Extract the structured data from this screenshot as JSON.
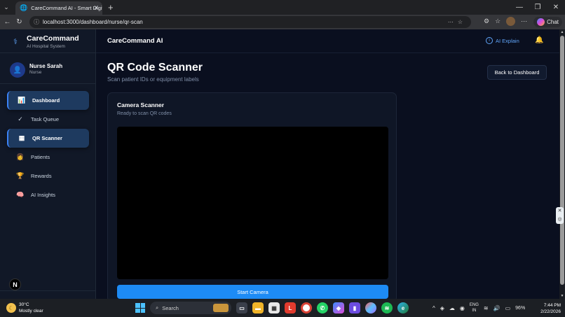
{
  "browser": {
    "tab_title": "CareCommand AI - Smart Digital H",
    "url": "localhost:3000/dashboard/nurse/qr-scan",
    "chat_label": "Chat"
  },
  "sidebar": {
    "brand_name": "CareCommand",
    "brand_sub": "AI Hospital System",
    "user_name": "Nurse Sarah",
    "user_role": "Nurse",
    "items": [
      {
        "label": "Dashboard",
        "icon": "📊"
      },
      {
        "label": "Task Queue",
        "icon": "✓"
      },
      {
        "label": "QR Scanner",
        "icon": "▦"
      },
      {
        "label": "Patients",
        "icon": "👩"
      },
      {
        "label": "Rewards",
        "icon": "🏆"
      },
      {
        "label": "AI Insights",
        "icon": "🧠"
      }
    ],
    "badge": "N"
  },
  "header": {
    "app_title": "CareCommand AI",
    "ai_explain": "AI Explain"
  },
  "page": {
    "title": "QR Code Scanner",
    "subtitle": "Scan patient IDs or equipment labels",
    "back_button": "Back to Dashboard"
  },
  "scanner": {
    "title": "Camera Scanner",
    "status": "Ready to scan QR codes",
    "start_button": "Start Camera"
  },
  "taskbar": {
    "temp": "30°C",
    "weather": "Mostly clear",
    "search_placeholder": "Search",
    "lang_top": "ENG",
    "lang_bottom": "IN",
    "battery": "96%",
    "time": "7:44 PM",
    "date": "2/22/2026"
  }
}
